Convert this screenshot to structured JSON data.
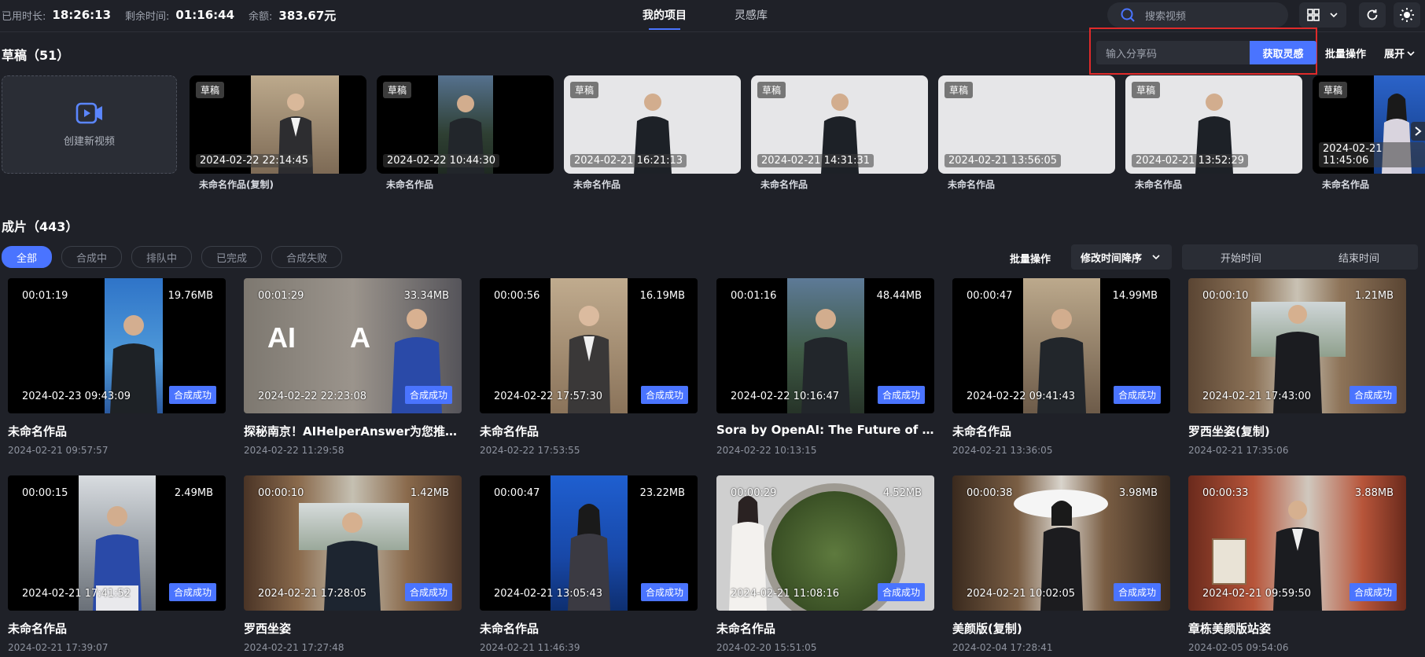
{
  "topbar": {
    "used_label": "已用时长:",
    "used_value": "18:26:13",
    "remain_label": "剩余时间:",
    "remain_value": "01:16:44",
    "balance_label": "余额:",
    "balance_value": "383.67元",
    "tabs": [
      {
        "label": "我的项目",
        "active": true
      },
      {
        "label": "灵感库",
        "active": false
      }
    ],
    "search_placeholder": "搜索视频"
  },
  "drafts": {
    "title": "草稿（51）",
    "share_placeholder": "输入分享码",
    "share_button": "获取灵感",
    "batch": "批量操作",
    "expand": "展开",
    "create_label": "创建新视频",
    "tag": "草稿",
    "items": [
      {
        "date": "2024-02-22 22:14:45",
        "name": "未命名作品(复制)",
        "tag": ""
      },
      {
        "date": "2024-02-22 10:44:30",
        "name": "未命名作品",
        "tag": ""
      },
      {
        "date": "2024-02-21 16:21:13",
        "name": "未命名作品",
        "tag": ""
      },
      {
        "date": "2024-02-21 14:31:31",
        "name": "未命名作品",
        "tag": ""
      },
      {
        "date": "2024-02-21 13:56:05",
        "name": "未命名作品",
        "tag": ""
      },
      {
        "date": "2024-02-21 13:52:29",
        "name": "未命名作品",
        "tag": ""
      },
      {
        "date": "2024-02-21 11:45:06",
        "name": "未命名作品",
        "tag": ""
      }
    ]
  },
  "products": {
    "title": "成片（443）",
    "filters": [
      "全部",
      "合成中",
      "排队中",
      "已完成",
      "合成失败"
    ],
    "batch": "批量操作",
    "sort": "修改时间降序",
    "start_time": "开始时间",
    "end_time": "结束时间",
    "status_label": "合成成功",
    "items": [
      {
        "dur": "00:01:19",
        "size": "19.76MB",
        "date": "2024-02-23 09:43:09",
        "title": "未命名作品",
        "time": "2024-02-21 09:57:57"
      },
      {
        "dur": "00:01:29",
        "size": "33.34MB",
        "date": "2024-02-22 22:23:08",
        "title": "探秘南京！AIHelperAnswer为您推荐两...",
        "time": "2024-02-22 11:29:58"
      },
      {
        "dur": "00:00:56",
        "size": "16.19MB",
        "date": "2024-02-22 17:57:30",
        "title": "未命名作品",
        "time": "2024-02-22 17:53:55"
      },
      {
        "dur": "00:01:16",
        "size": "48.44MB",
        "date": "2024-02-22 10:16:47",
        "title": "Sora by OpenAI: The Future of Video ...",
        "time": "2024-02-22 10:13:15"
      },
      {
        "dur": "00:00:47",
        "size": "14.99MB",
        "date": "2024-02-22 09:41:43",
        "title": "未命名作品",
        "time": "2024-02-21 13:36:05"
      },
      {
        "dur": "00:00:10",
        "size": "1.21MB",
        "date": "2024-02-21 17:43:00",
        "title": "罗西坐姿(复制)",
        "time": "2024-02-21 17:35:06"
      },
      {
        "dur": "00:00:15",
        "size": "2.49MB",
        "date": "2024-02-21 17:41:52",
        "title": "未命名作品",
        "time": "2024-02-21 17:39:07"
      },
      {
        "dur": "00:00:10",
        "size": "1.42MB",
        "date": "2024-02-21 17:28:05",
        "title": "罗西坐姿",
        "time": "2024-02-21 17:27:48"
      },
      {
        "dur": "00:00:47",
        "size": "23.22MB",
        "date": "2024-02-21 13:05:43",
        "title": "未命名作品",
        "time": "2024-02-21 11:46:39"
      },
      {
        "dur": "00:00:29",
        "size": "4.52MB",
        "date": "2024-02-21 11:08:16",
        "title": "未命名作品",
        "time": "2024-02-20 15:51:05"
      },
      {
        "dur": "00:00:38",
        "size": "3.98MB",
        "date": "2024-02-21 10:02:05",
        "title": "美颜版(复制)",
        "time": "2024-02-04 17:28:41"
      },
      {
        "dur": "00:00:33",
        "size": "3.88MB",
        "date": "2024-02-21 09:59:50",
        "title": "章栋美颜版站姿",
        "time": "2024-02-05 09:54:06"
      }
    ]
  },
  "colors": {
    "accent": "#4a74ff",
    "background": "#1f2128",
    "highlight_box": "#e02a2a"
  },
  "icons": [
    "search-icon",
    "grid-view-icon",
    "chevron-down-icon",
    "refresh-icon",
    "theme-sun-icon",
    "video-create-icon",
    "chevron-right-icon"
  ]
}
